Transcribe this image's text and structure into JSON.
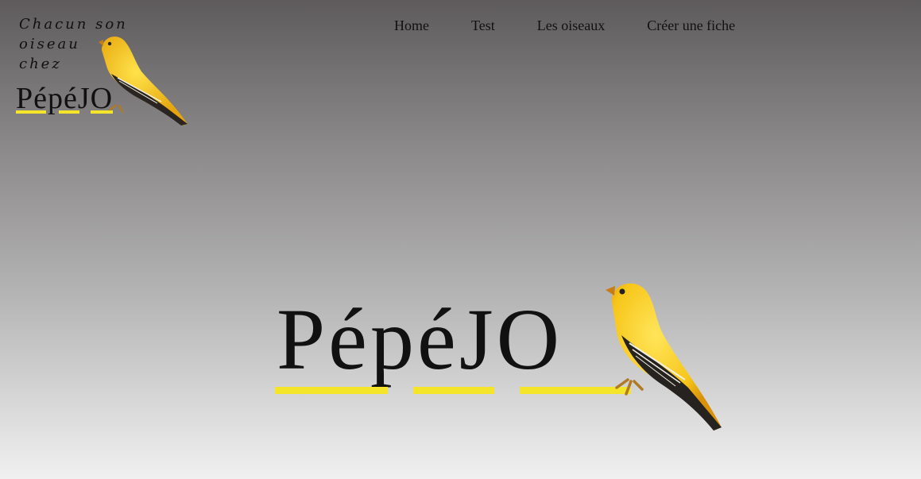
{
  "header": {
    "tagline": "Chacun son\noiseau\nchez",
    "brand": "PépéJO"
  },
  "nav": {
    "items": [
      {
        "label": "Home"
      },
      {
        "label": "Test"
      },
      {
        "label": "Les oiseaux"
      },
      {
        "label": "Créer une fiche"
      }
    ]
  },
  "hero": {
    "brand": "PépéJO"
  },
  "colors": {
    "accent_underline": "#f5e52a",
    "bird_yellow": "#f7c61a",
    "text": "#111111"
  },
  "icons": {
    "bird": "canary-bird-icon"
  }
}
